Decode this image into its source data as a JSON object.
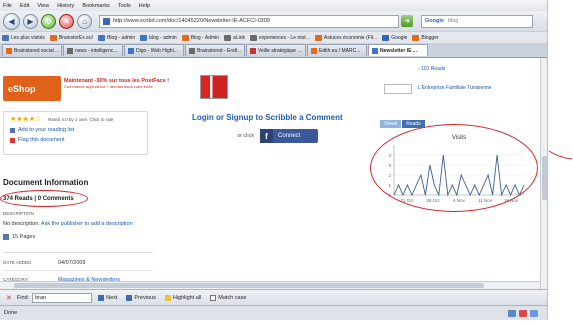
{
  "menubar": {
    "items": [
      "File",
      "Edit",
      "View",
      "History",
      "Bookmarks",
      "Tools",
      "Help"
    ]
  },
  "navbar": {
    "url": "http://www.scribd.com/doc/14045220/Newsletter-IE-ACFCI-0309",
    "search_engine_label": "Google",
    "search_placeholder": "blog"
  },
  "bookmarks": [
    {
      "label": "Les plus visités",
      "color": "#4b74b8"
    },
    {
      "label": "BrainstorEx.eu!",
      "color": "#e36a1b"
    },
    {
      "label": "Blog - admin",
      "color": "#3f76c4"
    },
    {
      "label": "blog - admin",
      "color": "#3f76c4"
    },
    {
      "label": "Blog - Admin",
      "color": "#e36a1b"
    },
    {
      "label": "aLink",
      "color": "#6a6a6a"
    },
    {
      "label": "experiences - Le mot...",
      "color": "#6a6a6a"
    },
    {
      "label": "Astuces économie (Fil...",
      "color": "#e36a1b"
    },
    {
      "label": "Google",
      "color": "#3160c9"
    },
    {
      "label": "Blogger",
      "color": "#e36a1b"
    }
  ],
  "tabs": [
    {
      "label": "Brainstored social ...",
      "color": "#e36a1b",
      "active": false
    },
    {
      "label": "news - intelligenc...",
      "color": "#6a6a6a",
      "active": false
    },
    {
      "label": "Digo - Web Highl...",
      "color": "#3f76c4",
      "active": false
    },
    {
      "label": "Brainstored - Endl...",
      "color": "#6a6a6a",
      "active": false
    },
    {
      "label": "Veille stratégique ...",
      "color": "#c03a2b",
      "active": false
    },
    {
      "label": "Edith.eu / MARC...",
      "color": "#e36a1b",
      "active": false
    },
    {
      "label": "Newsletter IE ...",
      "color": "#3f76c4",
      "active": true
    }
  ],
  "page": {
    "eshop_label": "eShop",
    "promo_line1": "Maintenant -30% sur tous les PostFace !",
    "promo_line2": "Commande aujourd'hui + demain dans votre boîte",
    "rating_text": "Rated 4.0 by 1 user. Click to rate",
    "add_to_reading_list": "Add to your reading list",
    "flag_document": "Flag this document",
    "login_prompt": "Login or Signup to Scribble a Comment",
    "or_click": "or click",
    "connect_label": "Connect",
    "document_info_title": "Document Information",
    "reads_comments": "374 Reads | 0 Comments",
    "description_label": "DESCRIPTION",
    "no_description": "No description.",
    "ask_publisher": "Ask the publisher to add a description",
    "pages": "15 Pages",
    "date_added_label": "DATE ADDED",
    "date_added": "04/07/2009",
    "category_label": "CATEGORY",
    "category": "Magazines & Newsletters",
    "right_link1": "- 101 Reads",
    "right_link2": "L'Entreprise Familiale Tunisienne"
  },
  "stats_tabs": [
    "Views",
    "Reads"
  ],
  "findbar": {
    "label": "Find:",
    "value": "bran",
    "next": "Next",
    "previous": "Previous",
    "highlight": "Highlight all",
    "match_case": "Match case"
  },
  "statusbar": {
    "text": "Done"
  },
  "chart_data": {
    "type": "line",
    "title": "Visits",
    "x_tick_labels": [
      "21 Oct",
      "28 Oct",
      "4 Nov",
      "11 Nov",
      "18 Nov"
    ],
    "y_tick_labels": [
      "0",
      "1",
      "2",
      "3",
      "4"
    ],
    "ylim": [
      0,
      5
    ],
    "values": [
      0,
      1,
      0,
      1,
      0,
      1,
      2,
      0,
      3,
      1,
      0,
      4,
      0,
      1,
      0,
      2,
      1,
      0,
      1,
      0,
      1,
      2,
      0,
      4,
      0,
      1,
      0,
      1,
      0,
      1
    ],
    "grid": true,
    "color": "#3a5f8f"
  }
}
